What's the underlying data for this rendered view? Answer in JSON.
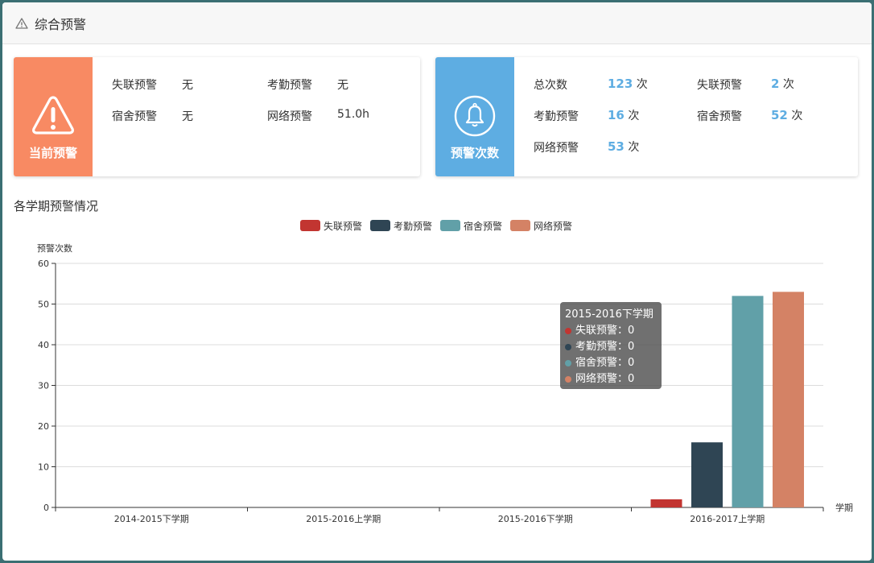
{
  "header": {
    "title": "综合预警",
    "icon": "warning-triangle-icon"
  },
  "current_alerts": {
    "label": "当前预警",
    "icon": "alert-triangle-icon",
    "color": "#f88a63",
    "items": [
      {
        "name": "失联预警",
        "value": "无"
      },
      {
        "name": "考勤预警",
        "value": "无"
      },
      {
        "name": "宿舍预警",
        "value": "无"
      },
      {
        "name": "网络预警",
        "value": "51.0h"
      }
    ]
  },
  "alert_counts": {
    "label": "预警次数",
    "icon": "bell-icon",
    "color": "#5eade2",
    "unit": "次",
    "items": [
      {
        "name": "总次数",
        "value": "123"
      },
      {
        "name": "失联预警",
        "value": "2"
      },
      {
        "name": "考勤预警",
        "value": "16"
      },
      {
        "name": "宿舍预警",
        "value": "52"
      },
      {
        "name": "网络预警",
        "value": "53"
      }
    ]
  },
  "section": {
    "title": "各学期预警情况"
  },
  "chart_data": {
    "type": "bar",
    "ylabel": "预警次数",
    "xlabel": "学期",
    "ylim": [
      0,
      60
    ],
    "yticks": [
      0,
      10,
      20,
      30,
      40,
      50,
      60
    ],
    "grid": true,
    "legend_position": "top-center",
    "categories": [
      "2014-2015下学期",
      "2015-2016上学期",
      "2015-2016下学期",
      "2016-2017上学期"
    ],
    "series": [
      {
        "name": "失联预警",
        "color": "#c23531",
        "values": [
          0,
          0,
          0,
          2
        ]
      },
      {
        "name": "考勤预警",
        "color": "#2f4554",
        "values": [
          0,
          0,
          0,
          16
        ]
      },
      {
        "name": "宿舍预警",
        "color": "#61a0a8",
        "values": [
          0,
          0,
          0,
          52
        ]
      },
      {
        "name": "网络预警",
        "color": "#d48265",
        "values": [
          0,
          0,
          0,
          53
        ]
      }
    ]
  },
  "tooltip": {
    "title": "2015-2016下学期",
    "rows": [
      {
        "name": "失联预警",
        "value": "0",
        "color": "#c23531"
      },
      {
        "name": "考勤预警",
        "value": "0",
        "color": "#2f4554"
      },
      {
        "name": "宿舍预警",
        "value": "0",
        "color": "#61a0a8"
      },
      {
        "name": "网络预警",
        "value": "0",
        "color": "#d48265"
      }
    ]
  }
}
